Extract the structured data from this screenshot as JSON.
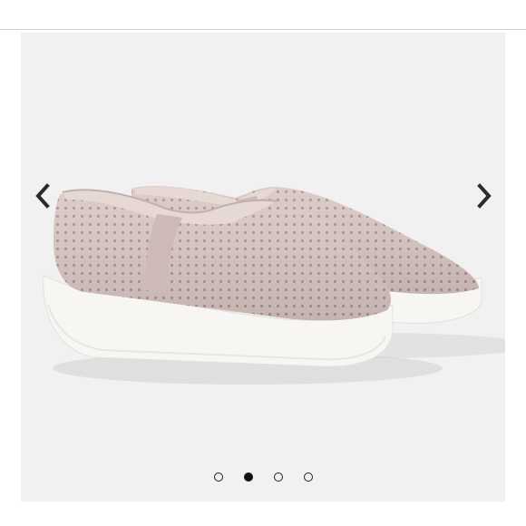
{
  "gallery": {
    "image": {
      "subject": "shoe-product-photo",
      "colors": {
        "background": "#f1f1f1",
        "upper": "#d7c6c3",
        "upper_shadow": "#c3b0ad",
        "perforation": "#a8918d",
        "sole": "#f7f6f2",
        "sole_shadow": "#e3e1dc",
        "lining": "#e6d8d3"
      }
    },
    "prev_icon": "chevron-left-icon",
    "next_icon": "chevron-right-icon",
    "slide_count": 4,
    "active_slide": 2
  }
}
